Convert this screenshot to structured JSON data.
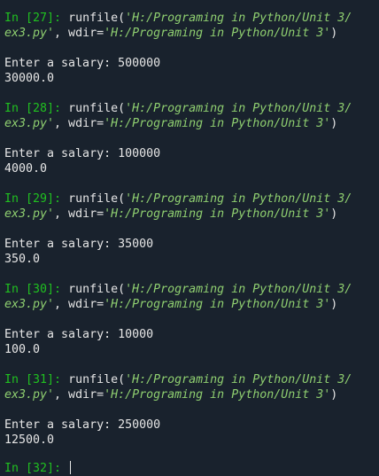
{
  "cells": [
    {
      "prompt": "In [27]: ",
      "func": "runfile(",
      "path": "'H:/Programing in Python/Unit 3/",
      "path2": "ex3.py'",
      "sep": ", wdir=",
      "wdir": "'H:/Programing in Python/Unit 3'",
      "close": ")",
      "input_label": "Enter a salary: ",
      "input_value": "500000",
      "output": "30000.0"
    },
    {
      "prompt": "In [28]: ",
      "func": "runfile(",
      "path": "'H:/Programing in Python/Unit 3/",
      "path2": "ex3.py'",
      "sep": ", wdir=",
      "wdir": "'H:/Programing in Python/Unit 3'",
      "close": ")",
      "input_label": "Enter a salary: ",
      "input_value": "100000",
      "output": "4000.0"
    },
    {
      "prompt": "In [29]: ",
      "func": "runfile(",
      "path": "'H:/Programing in Python/Unit 3/",
      "path2": "ex3.py'",
      "sep": ", wdir=",
      "wdir": "'H:/Programing in Python/Unit 3'",
      "close": ")",
      "input_label": "Enter a salary: ",
      "input_value": "35000",
      "output": "350.0"
    },
    {
      "prompt": "In [30]: ",
      "func": "runfile(",
      "path": "'H:/Programing in Python/Unit 3/",
      "path2": "ex3.py'",
      "sep": ", wdir=",
      "wdir": "'H:/Programing in Python/Unit 3'",
      "close": ")",
      "input_label": "Enter a salary: ",
      "input_value": "10000",
      "output": "100.0"
    },
    {
      "prompt": "In [31]: ",
      "func": "runfile(",
      "path": "'H:/Programing in Python/Unit 3/",
      "path2": "ex3.py'",
      "sep": ", wdir=",
      "wdir": "'H:/Programing in Python/Unit 3'",
      "close": ")",
      "input_label": "Enter a salary: ",
      "input_value": "250000",
      "output": "12500.0"
    }
  ],
  "current_prompt": "In [32]: ",
  "colors": {
    "background": "#19222d",
    "prompt": "#20c020",
    "string": "#8fcf70",
    "text": "#e6e6e6"
  }
}
